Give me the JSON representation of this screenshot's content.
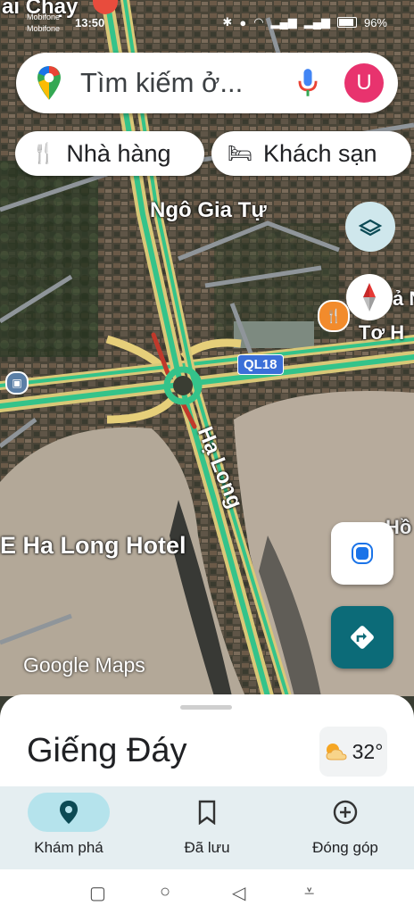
{
  "status": {
    "carrier1": "Mobifone",
    "carrier2": "Mobifone",
    "time": "13:50",
    "battery": "96%"
  },
  "search": {
    "placeholder": "Tìm kiếm ở...",
    "avatar_letter": "U",
    "pin_icon": "google-maps-pin-icon",
    "mic_icon": "microphone-icon"
  },
  "chips": [
    {
      "label": "Nhà hàng",
      "icon": "restaurant-icon"
    },
    {
      "label": "Khách sạn",
      "icon": "hotel-bed-icon"
    }
  ],
  "map_labels": {
    "top_partial": "ai Chạy",
    "street1": "Ngô Gia Tự",
    "road_shield": "QL18",
    "street2": "Hạ Long",
    "hotel": "E Ha Long Hotel",
    "right_partial1": "ả N",
    "right_partial2": "Tơ H",
    "right_partial3": "Hồ",
    "watermark": "Google Maps"
  },
  "sheet": {
    "place_name": "Giếng Đáy",
    "temperature": "32°",
    "weather_icon": "partly-cloudy-icon"
  },
  "bottom_nav": [
    {
      "label": "Khám phá",
      "icon": "location-pin-icon",
      "active": true
    },
    {
      "label": "Đã lưu",
      "icon": "bookmark-icon",
      "active": false
    },
    {
      "label": "Đóng góp",
      "icon": "add-circle-icon",
      "active": false
    }
  ],
  "colors": {
    "accent": "#0c6b78",
    "avatar": "#e8336e",
    "traffic_green": "#34c38a",
    "nav_active": "#b5e3ec"
  }
}
